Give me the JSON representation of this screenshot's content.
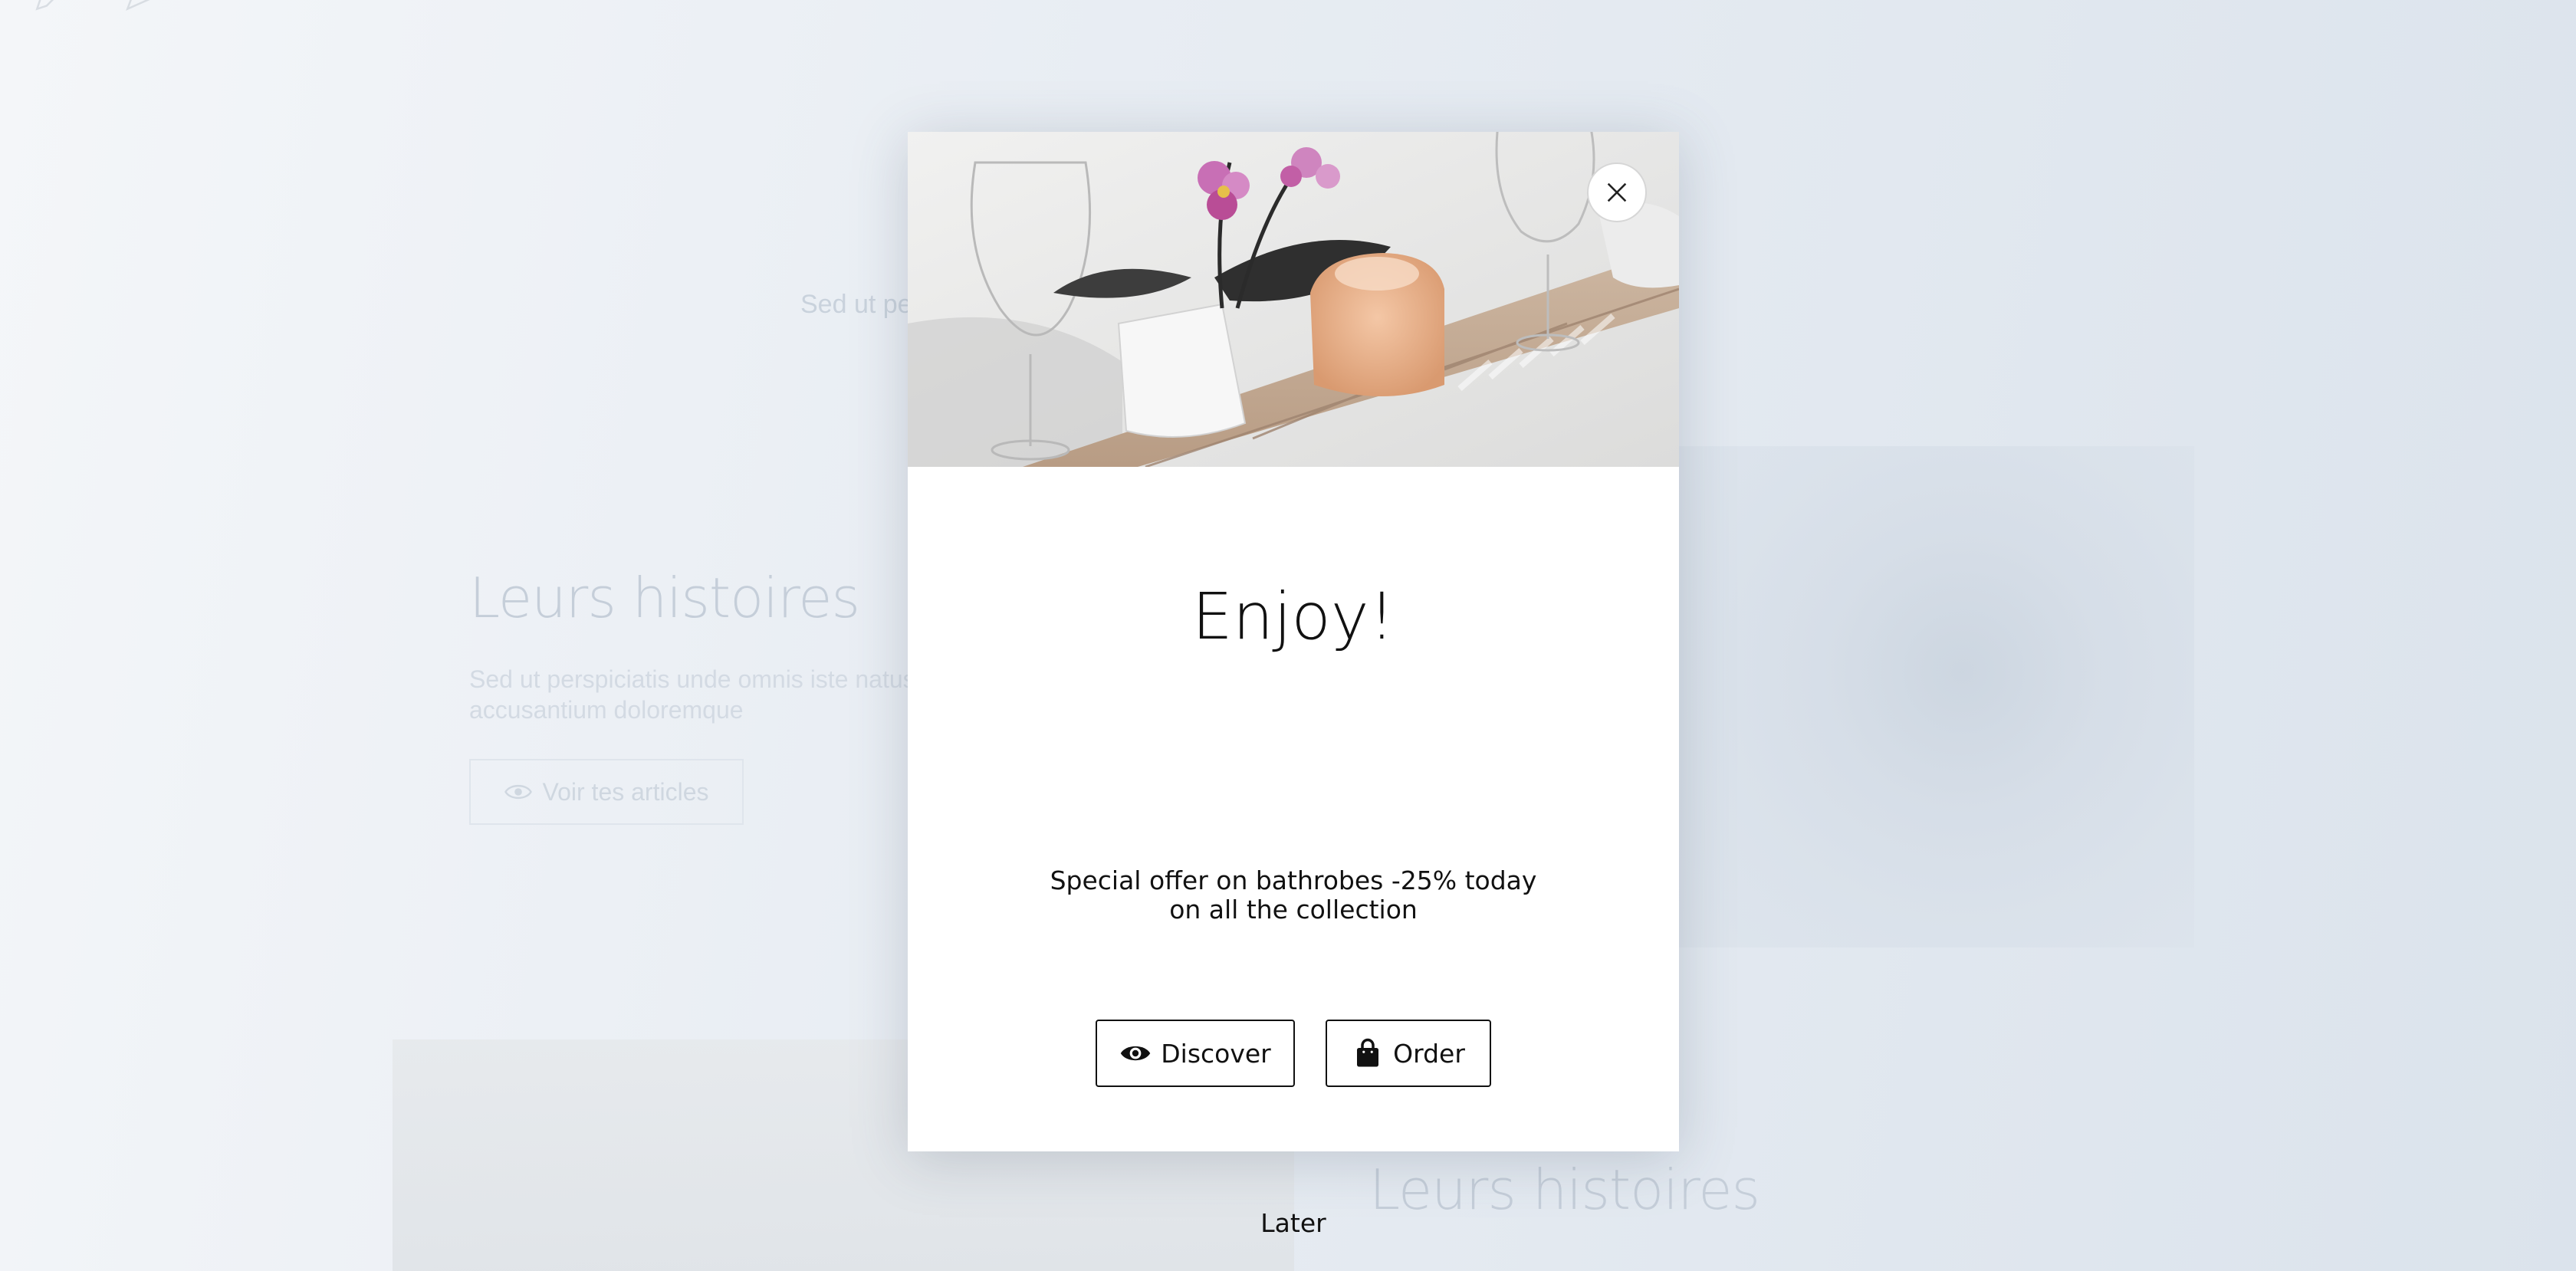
{
  "background": {
    "nav": [
      {
        "label": "",
        "icon": "pencil-icon"
      },
      {
        "label": "",
        "icon": "send-icon"
      }
    ],
    "intro_text": "Sed ut pe…onque",
    "section_one": {
      "heading": "Leurs histoires",
      "text": "Sed ut perspiciatis unde omnis iste natus accusantium doloremque",
      "button_label": "Voir tes articles",
      "button_icon": "eye-icon"
    },
    "section_two": {
      "heading": "Leurs histoires"
    }
  },
  "modal": {
    "hero_image": "bathroom-tray-orchid-wine-glasses-photo",
    "close_icon": "close-icon",
    "title": "Enjoy!",
    "text": "Special offer on bathrobes -25% today on all the collection",
    "buttons": {
      "discover": {
        "label": "Discover",
        "icon": "eye-icon"
      },
      "order": {
        "label": "Order",
        "icon": "shopping-bag-icon"
      }
    },
    "later_label": "Later"
  },
  "colors": {
    "text": "#111111",
    "modal_bg": "#ffffff",
    "page_bg": "#e9eef4"
  }
}
